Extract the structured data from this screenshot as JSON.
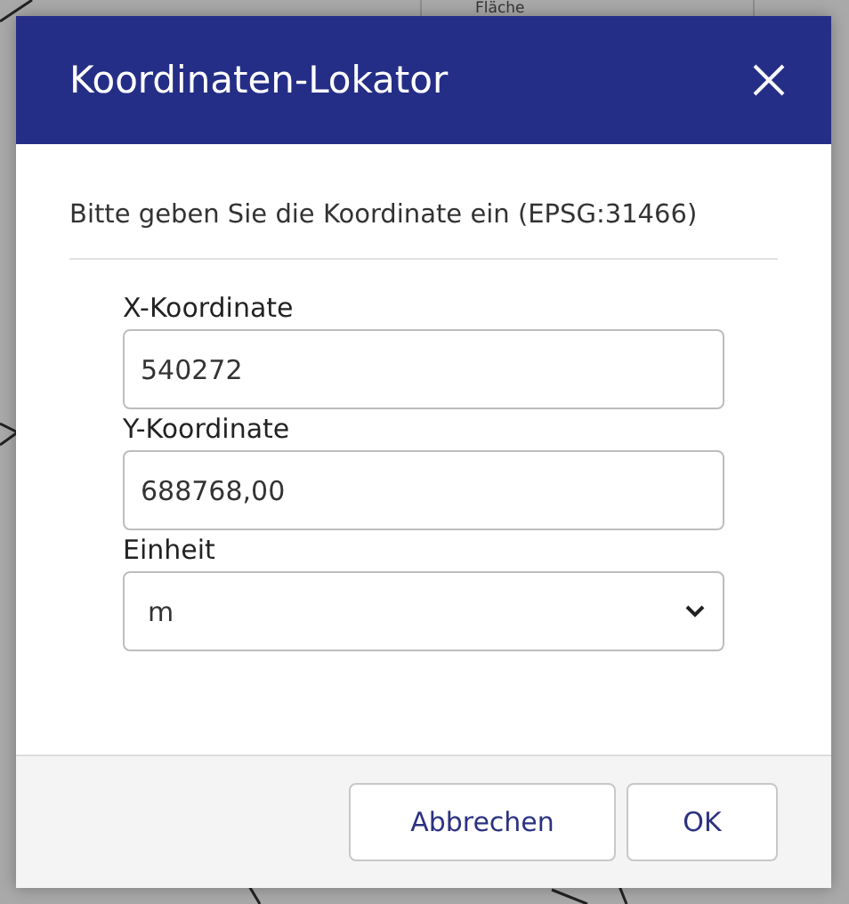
{
  "background": {
    "label": "Fläche"
  },
  "dialog": {
    "title": "Koordinaten-Lokator",
    "instruction": "Bitte geben Sie die Koordinate ein (EPSG:31466)",
    "fields": [
      {
        "kind": "text",
        "label": "X-Koordinate",
        "value": "540272"
      },
      {
        "kind": "text",
        "label": "Y-Koordinate",
        "value": "688768,00"
      },
      {
        "kind": "select",
        "label": "Einheit",
        "value": "m"
      }
    ],
    "buttons": [
      "Abbrechen",
      "OK"
    ]
  }
}
